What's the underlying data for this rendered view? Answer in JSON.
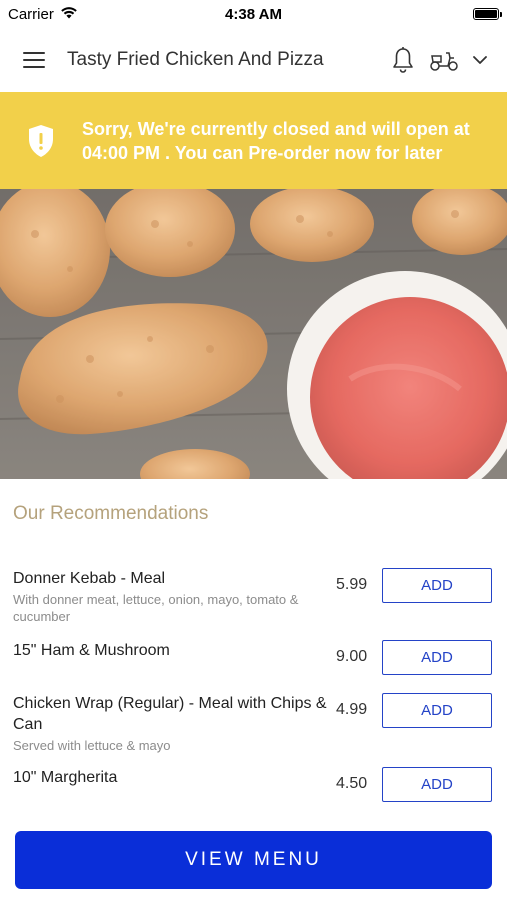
{
  "status_bar": {
    "carrier": "Carrier",
    "time": "4:38 AM",
    "wifi_icon": "wifi-icon",
    "battery_icon": "battery-icon"
  },
  "header": {
    "title": "Tasty Fried Chicken And Pizza",
    "menu_icon": "hamburger-menu-icon",
    "notification_icon": "bell-icon",
    "delivery_icon": "scooter-icon",
    "dropdown_icon": "chevron-down-icon"
  },
  "banner": {
    "message": "Sorry, We're currently closed and will open at 04:00 PM . You can Pre-order now for later",
    "icon": "shield-alert-icon",
    "background_color": "#f2d04a"
  },
  "hero": {
    "image_icon": "fried-chicken-photo"
  },
  "recommendations": {
    "title": "Our Recommendations",
    "items": [
      {
        "name": "Donner Kebab - Meal",
        "description": "With donner meat, lettuce, onion, mayo, tomato & cucumber",
        "price": "5.99",
        "add_label": "ADD"
      },
      {
        "name": "15\" Ham & Mushroom",
        "description": "",
        "price": "9.00",
        "add_label": "ADD"
      },
      {
        "name": "Chicken Wrap (Regular) - Meal with Chips & Can",
        "description": "Served with lettuce & mayo",
        "price": "4.99",
        "add_label": "ADD"
      },
      {
        "name": "10\" Margherita",
        "description": "",
        "price": "4.50",
        "add_label": "ADD"
      }
    ]
  },
  "footer": {
    "view_menu_label": "VIEW MENU",
    "accent_color": "#0a2ed8"
  }
}
